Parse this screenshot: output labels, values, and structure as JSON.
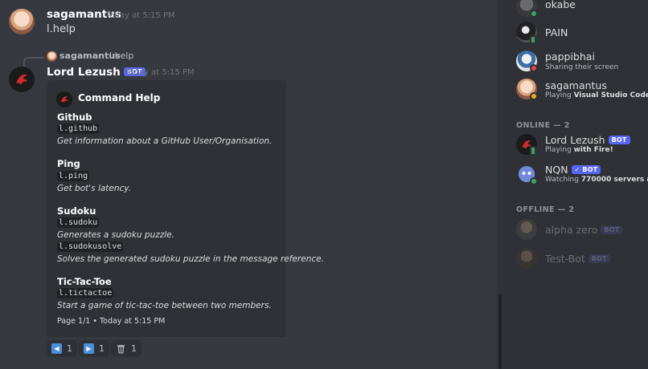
{
  "messages": [
    {
      "author": "sagamantus",
      "timestamp": "Today at 5:15 PM",
      "text": "l.help"
    },
    {
      "reply": {
        "author": "sagamantus",
        "text": "l.help"
      },
      "author": "Lord Lezush",
      "tag": "BOT",
      "timestamp": "Today at 5:15 PM",
      "embed": {
        "author": "Command Help",
        "fields": [
          {
            "name": "Github",
            "commands": [
              {
                "code": "l.github",
                "desc": "Get information about a GitHub User/Organisation."
              }
            ]
          },
          {
            "name": "Ping",
            "commands": [
              {
                "code": "l.ping",
                "desc": "Get bot's latency."
              }
            ]
          },
          {
            "name": "Sudoku",
            "commands": [
              {
                "code": "l.sudoku",
                "desc": "Generates a sudoku puzzle."
              },
              {
                "code": "l.sudokusolve",
                "desc": "Solves the generated sudoku puzzle in the message reference."
              }
            ]
          },
          {
            "name": "Tic-Tac-Toe",
            "commands": [
              {
                "code": "l.tictactoe",
                "desc": "Start a game of tic-tac-toe between two members."
              }
            ]
          }
        ],
        "footer": "Page 1/1 • Today at 5:15 PM"
      },
      "reactions": [
        {
          "emoji": "arrow-backward-icon",
          "glyph": "◀",
          "count": "1"
        },
        {
          "emoji": "arrow-forward-icon",
          "glyph": "▶",
          "count": "1"
        },
        {
          "emoji": "wastebasket-icon",
          "glyph": "",
          "count": "1"
        }
      ]
    }
  ],
  "members": {
    "top_list": [
      {
        "name": "okabe",
        "activity": "",
        "status": "online"
      },
      {
        "name": "PAIN",
        "activity": "",
        "status": "mobile"
      },
      {
        "name": "pappibhai",
        "activity": "Sharing their screen",
        "status": "dnd"
      },
      {
        "name": "sagamantus",
        "activity_prefix": "Playing ",
        "activity_bold": "Visual Studio Code",
        "status": "idle"
      }
    ],
    "online_header": "ONLINE — 2",
    "online": [
      {
        "name": "Lord Lezush",
        "tag": "BOT",
        "activity_prefix": "Playing ",
        "activity_bold": "with Fire!",
        "status": "mobile"
      },
      {
        "name": "NQN",
        "tag": "✓ BOT",
        "activity_prefix": "Watching ",
        "activity_bold": "770000 servers an...",
        "status": "online"
      }
    ],
    "offline_header": "OFFLINE — 2",
    "offline": [
      {
        "name": "alpha zero",
        "tag": "BOT"
      },
      {
        "name": "Test-Bot",
        "tag": "BOT"
      }
    ]
  },
  "colors": {
    "background": "#36393f",
    "sidebar": "#2f3136",
    "embed": "#2f3136",
    "blurple": "#5865f2",
    "online": "#3ba55d",
    "dnd": "#ed4245",
    "idle": "#faa81a"
  }
}
